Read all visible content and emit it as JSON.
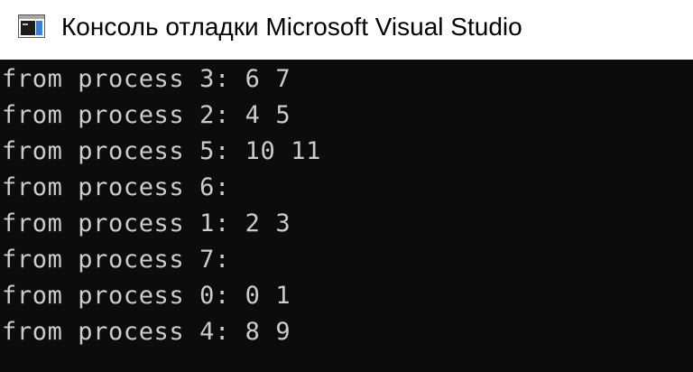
{
  "window": {
    "title": "Консоль отладки Microsoft Visual Studio",
    "icon": "console-app-icon"
  },
  "colors": {
    "console_background": "#0c0c0c",
    "console_text": "#cccccc",
    "titlebar_background": "#ffffff"
  },
  "console": {
    "lines": [
      "from process 3: 6 7",
      "from process 2: 4 5",
      "from process 5: 10 11",
      "from process 6:",
      "from process 1: 2 3",
      "from process 7:",
      "from process 0: 0 1",
      "from process 4: 8 9"
    ]
  }
}
